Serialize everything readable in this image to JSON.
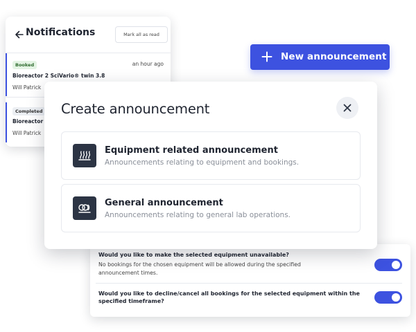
{
  "notifications": {
    "title": "Notifications",
    "back_icon": "arrow-left-icon",
    "mark_all_read_label": "Mark all as read",
    "items": [
      {
        "status": "Booked",
        "time": "an hour ago",
        "equipment": "Bioreactor 2 SciVario® twin 3.8",
        "user": "Will Patrick"
      },
      {
        "status": "Completed",
        "equipment": "Bioreactor",
        "user": "Will Patrick"
      }
    ]
  },
  "new_announcement_button": {
    "label": "New announcement",
    "icon": "plus-icon",
    "color": "#3d52e0"
  },
  "modal": {
    "title": "Create announcement",
    "close_icon": "close-icon",
    "options": [
      {
        "title": "Equipment related announcement",
        "description": "Announcements relating to equipment and bookings.",
        "icon": "equipment-icon"
      },
      {
        "title": "General announcement",
        "description": "Announcements relating to general lab operations.",
        "icon": "general-operations-icon"
      }
    ]
  },
  "settings": {
    "questions": [
      {
        "question": "Would you like to make the selected equipment unavailable?",
        "description": "No bookings for the chosen equipment will be allowed during the specified announcement times.",
        "enabled": true
      },
      {
        "question": "Would you like to decline/cancel all bookings for the selected equipment within the specified timeframe?",
        "enabled": true
      }
    ]
  }
}
